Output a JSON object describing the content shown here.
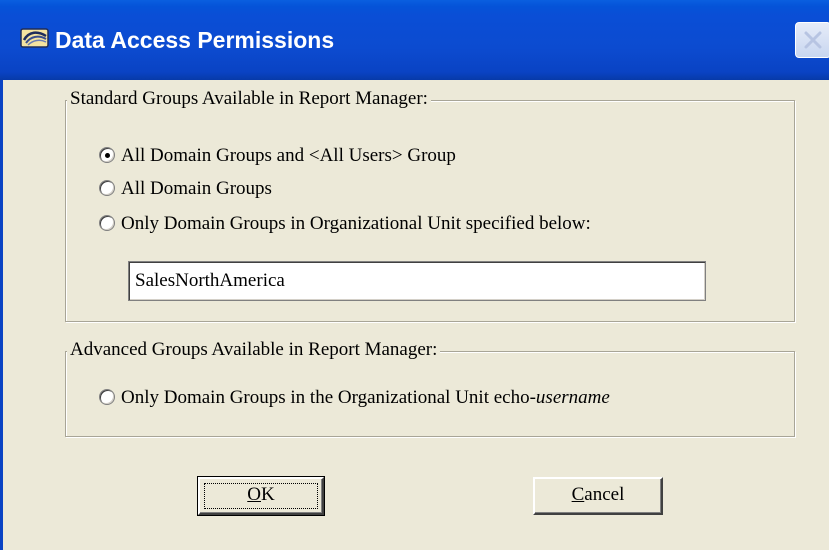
{
  "window": {
    "title": "Data Access Permissions",
    "titlebar_color": "#0a4ed6",
    "icon": "app-icon"
  },
  "standard_group": {
    "legend": "Standard Groups Available in Report Manager:",
    "options": [
      {
        "label": "All Domain Groups and <All Users> Group",
        "selected": true
      },
      {
        "label": "All Domain Groups",
        "selected": false
      },
      {
        "label": "Only Domain Groups in Organizational Unit specified below:",
        "selected": false
      }
    ],
    "ou_value": "SalesNorthAmerica"
  },
  "advanced_group": {
    "legend": "Advanced Groups Available in Report Manager:",
    "option": {
      "label_prefix": "Only Domain Groups in the Organizational Unit echo-",
      "label_italic": "username",
      "selected": false
    }
  },
  "buttons": {
    "ok": {
      "mnemonic": "O",
      "rest": "K"
    },
    "cancel": {
      "mnemonic": "C",
      "rest": "ancel"
    }
  }
}
